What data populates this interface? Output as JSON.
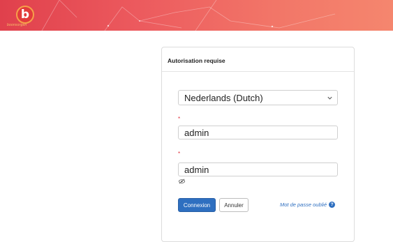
{
  "banner": {
    "brand_text": "boonsorgen",
    "logo_glyph": "b",
    "colors": {
      "start": "#e0404c",
      "end": "#f5866e"
    }
  },
  "login": {
    "title": "Autorisation requise",
    "language": {
      "selected": "Nederlands (Dutch)"
    },
    "required_marker": "*",
    "username": {
      "value": "admin"
    },
    "password": {
      "value": "admin"
    },
    "connect_label": "Connexion",
    "cancel_label": "Annuler",
    "forgot_label": "Mot de passe oublié",
    "help_glyph": "?",
    "colors": {
      "primary": "#2e6fc0",
      "required": "#e0303c"
    }
  },
  "icons": {
    "logo": "boonsorgen-logo-icon",
    "dropdown": "chevron-down-icon",
    "visibility": "eye-slash-icon",
    "help": "question-circle-icon"
  }
}
